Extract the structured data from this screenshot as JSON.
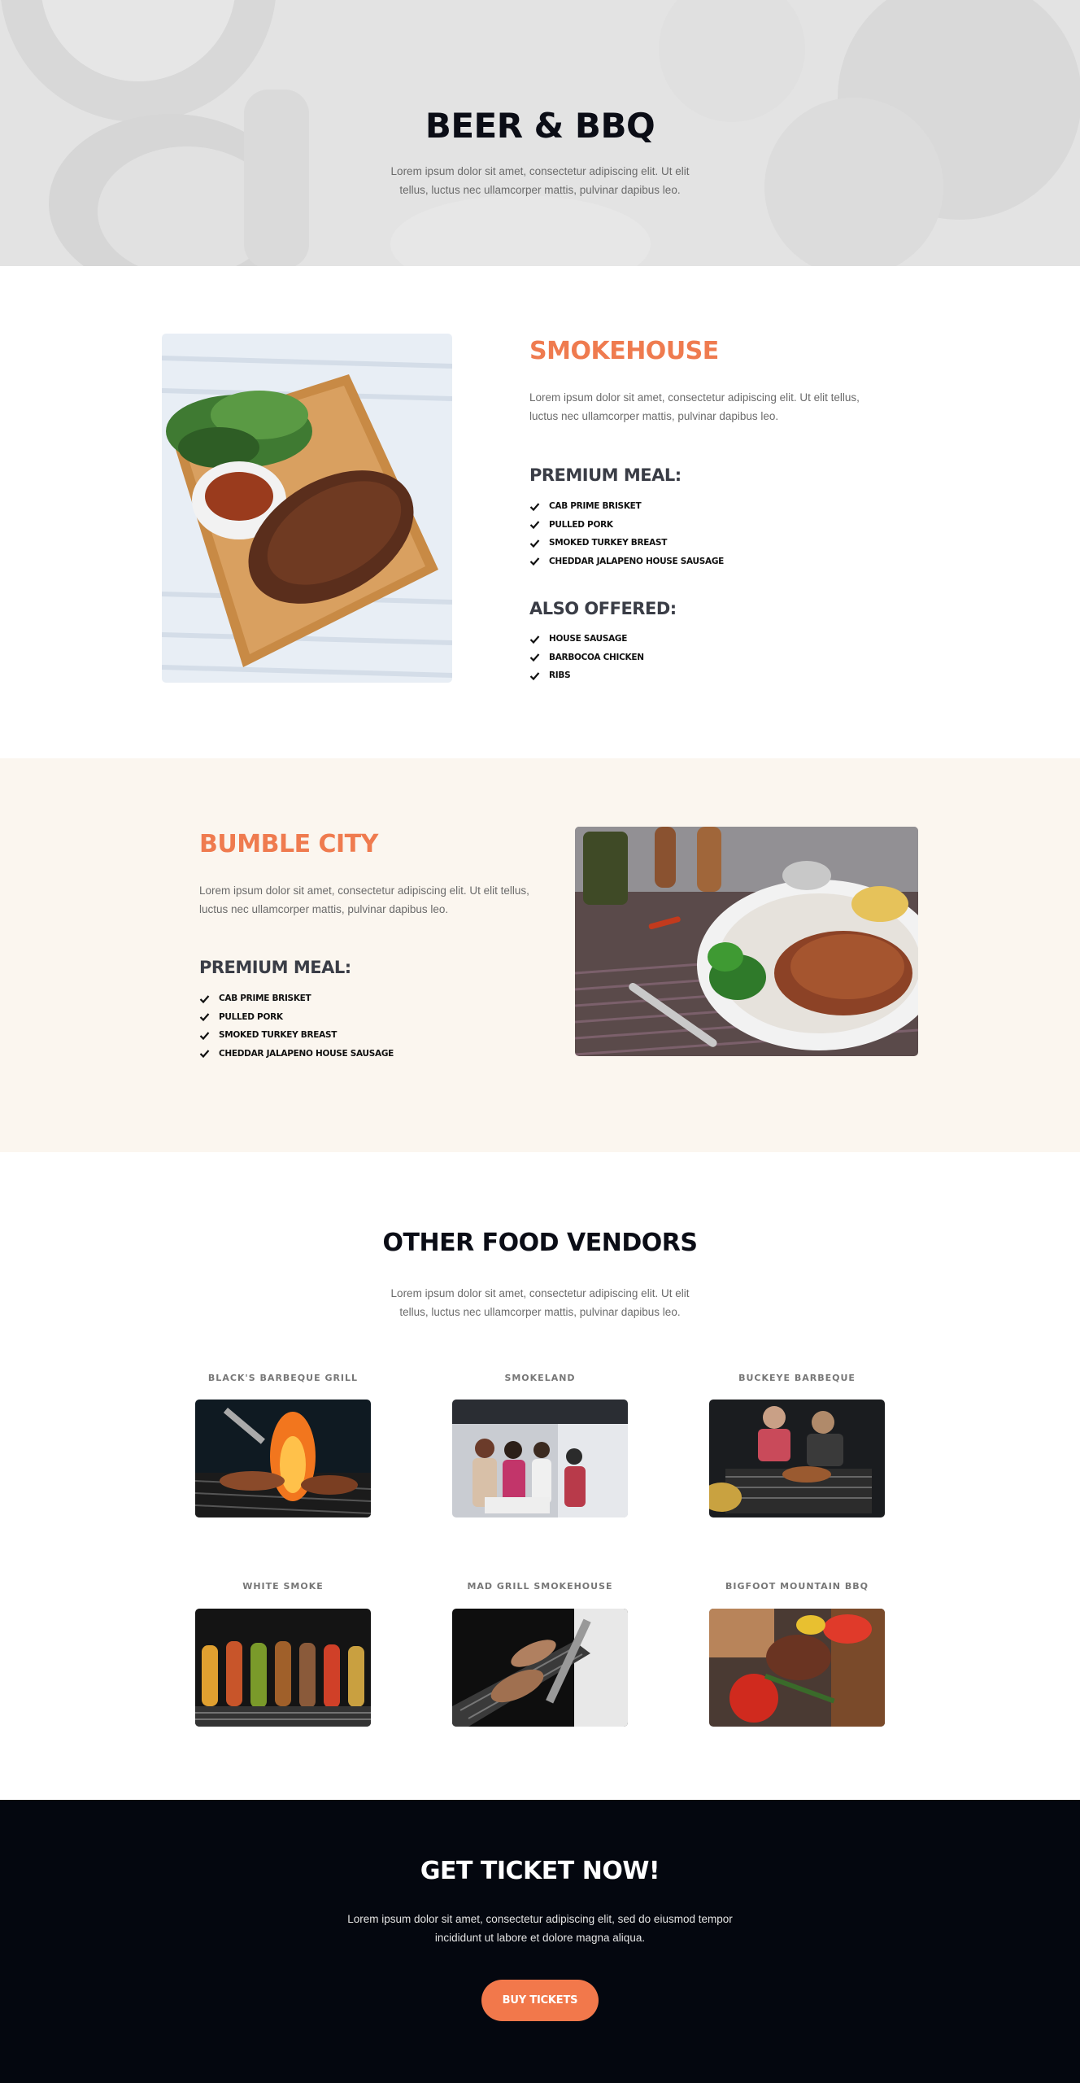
{
  "hero": {
    "title": "BEER & BBQ",
    "description": "Lorem ipsum dolor sit amet, consectetur adipiscing elit. Ut elit tellus, luctus nec ullamcorper mattis, pulvinar dapibus leo."
  },
  "smokehouse": {
    "title": "SMOKEHOUSE",
    "description": "Lorem ipsum dolor sit amet, consectetur adipiscing elit. Ut elit tellus, luctus nec ullamcorper mattis, pulvinar dapibus leo.",
    "premium_heading": "PREMIUM MEAL:",
    "premium_items": [
      "CAB PRIME BRISKET",
      "PULLED PORK",
      "SMOKED TURKEY BREAST",
      "CHEDDAR JALAPENO HOUSE SAUSAGE"
    ],
    "also_heading": "ALSO OFFERED:",
    "also_items": [
      "HOUSE SAUSAGE",
      "BARBOCOA CHICKEN",
      "RIBS"
    ],
    "image_icon": "steak-board-image"
  },
  "bumble": {
    "title": "BUMBLE CITY",
    "description": "Lorem ipsum dolor sit amet, consectetur adipiscing elit. Ut elit tellus, luctus nec ullamcorper mattis, pulvinar dapibus leo.",
    "premium_heading": "PREMIUM MEAL:",
    "premium_items": [
      "CAB PRIME BRISKET",
      "PULLED PORK",
      "SMOKED TURKEY BREAST",
      "CHEDDAR JALAPENO HOUSE SAUSAGE"
    ],
    "image_icon": "grilled-meat-plate-image"
  },
  "vendors": {
    "title": "OTHER FOOD VENDORS",
    "description": "Lorem ipsum dolor sit amet, consectetur adipiscing elit. Ut elit tellus, luctus nec ullamcorper mattis, pulvinar dapibus leo.",
    "items": [
      {
        "name": "BLACK'S BARBEQUE GRILL",
        "image_icon": "flaming-grill-image"
      },
      {
        "name": "SMOKELAND",
        "image_icon": "food-truck-crowd-image"
      },
      {
        "name": "BUCKEYE BARBEQUE",
        "image_icon": "grill-cooks-image"
      },
      {
        "name": "WHITE SMOKE",
        "image_icon": "skewers-grill-image"
      },
      {
        "name": "MAD GRILL SMOKEHOUSE",
        "image_icon": "grill-tongs-image"
      },
      {
        "name": "BIGFOOT MOUNTAIN BBQ",
        "image_icon": "steak-peppers-image"
      }
    ]
  },
  "cta": {
    "title": "GET TICKET NOW!",
    "description": "Lorem ipsum dolor sit amet, consectetur adipiscing elit, sed do eiusmod tempor incididunt ut labore et dolore magna aliqua.",
    "button_label": "BUY TICKETS"
  },
  "colors": {
    "accent": "#ef7b4f",
    "button": "#f2784b",
    "dark": "#04070f",
    "cream": "#fbf6ef"
  }
}
